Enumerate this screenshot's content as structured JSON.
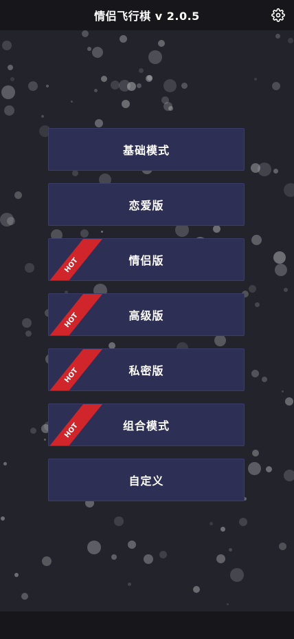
{
  "header": {
    "title": "情侣飞行棋 v 2.0.5",
    "settings_icon": "gear-icon"
  },
  "menu": {
    "items": [
      {
        "label": "基础模式",
        "hot": false
      },
      {
        "label": "恋爱版",
        "hot": false
      },
      {
        "label": "情侣版",
        "hot": true
      },
      {
        "label": "高级版",
        "hot": true
      },
      {
        "label": "私密版",
        "hot": true
      },
      {
        "label": "组合模式",
        "hot": true
      },
      {
        "label": "自定义",
        "hot": false
      }
    ],
    "hot_badge": "HOT"
  },
  "colors": {
    "background": "#23232c",
    "bar": "#16161b",
    "button": "#2e2f55",
    "ribbon": "#d0262b"
  }
}
